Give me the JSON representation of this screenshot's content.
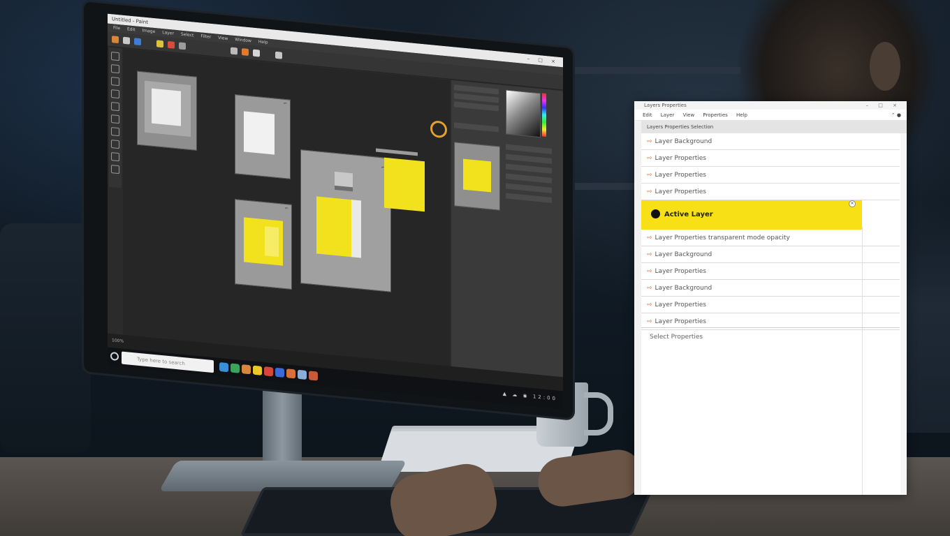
{
  "editor": {
    "title": "Untitled - Paint",
    "menu": [
      "File",
      "Edit",
      "Image",
      "Layer",
      "Select",
      "Filter",
      "View",
      "Window",
      "Help"
    ],
    "status": "100%",
    "taskbar": {
      "search_placeholder": "Type here to search",
      "clock": "12:00"
    }
  },
  "dialog": {
    "title": "Layers Properties",
    "window_controls": "– □ ×",
    "tabs": [
      "Edit",
      "Layer",
      "View",
      "Properties",
      "Help"
    ],
    "subheader": "Layers Properties Selection",
    "items": [
      {
        "label": "Layer Background"
      },
      {
        "label": "Layer Properties"
      },
      {
        "label": "Layer Properties"
      },
      {
        "label": "Layer Properties"
      },
      {
        "label": "Active Layer",
        "selected": true
      },
      {
        "label": "Layer Properties transparent mode opacity"
      },
      {
        "label": "Layer Background"
      },
      {
        "label": "Layer Properties"
      },
      {
        "label": "Layer Background"
      },
      {
        "label": "Layer Properties"
      },
      {
        "label": "Layer Properties"
      }
    ],
    "footer": "Select Properties"
  },
  "colors": {
    "accent": "#f7e016",
    "arrow": "#e06a2a"
  }
}
